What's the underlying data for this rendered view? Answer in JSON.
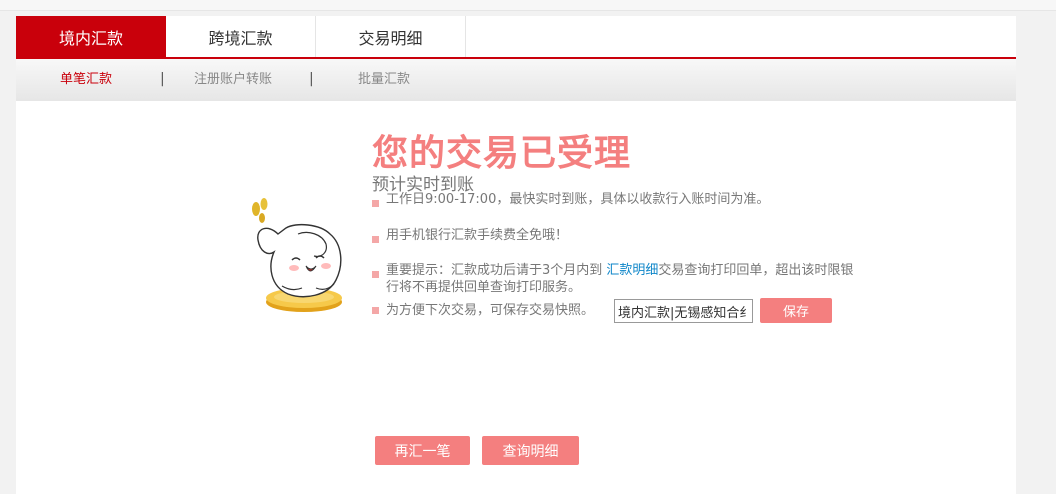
{
  "tabs": [
    {
      "label": "境内汇款",
      "active": true
    },
    {
      "label": "跨境汇款",
      "active": false
    },
    {
      "label": "交易明细",
      "active": false
    }
  ],
  "subnav": {
    "items": [
      {
        "label": "单笔汇款",
        "active": true
      },
      {
        "label": "注册账户转账",
        "active": false
      },
      {
        "label": "批量汇款",
        "active": false
      }
    ],
    "separator": "|"
  },
  "result": {
    "title": "您的交易已受理",
    "subtitle": "预计实时到账",
    "notes": [
      "工作日9:00-17:00，最快实时到账，具体以收款行入账时间为准。",
      "用手机银行汇款手续费全免哦！"
    ],
    "tip_prefix": "重要提示：汇款成功后请于3个月内到 ",
    "tip_link": "汇款明细",
    "tip_suffix_line1": "交易查询打印回单，超出该时限银",
    "tip_line2": "行将不再提供回单查询打印服务。",
    "snapshot_label": "为方便下次交易，可保存交易快照。",
    "snapshot_value": "境内汇款|无锡感知合纟",
    "save_label": "保存"
  },
  "actions": {
    "again_label": "再汇一笔",
    "details_label": "查询明细"
  },
  "colors": {
    "brand_red": "#c9000b",
    "accent_pink": "#f47f7f",
    "link_blue": "#0e86c9"
  }
}
